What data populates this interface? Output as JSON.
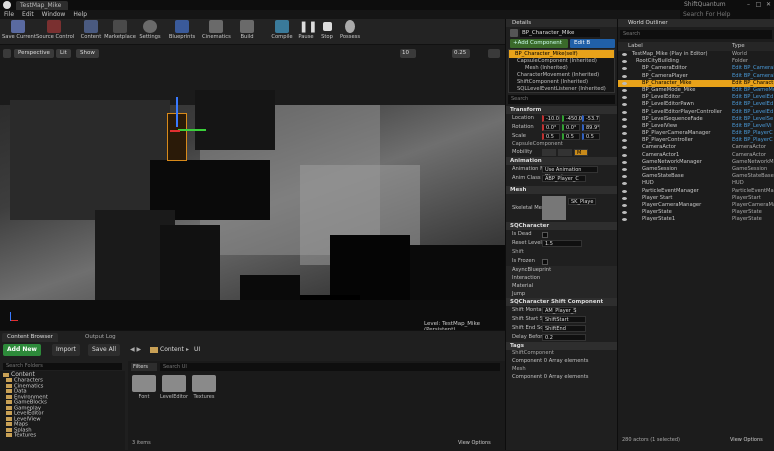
{
  "titlebar": {
    "tab": "TestMap_Mike",
    "project": "ShiftQuantum"
  },
  "menu": [
    "File",
    "Edit",
    "Window",
    "Help"
  ],
  "help_placeholder": "Search For Help",
  "toolbar": [
    {
      "label": "Save Current",
      "color": "#5a6aa0"
    },
    {
      "label": "Source Control",
      "color": "#7a3030"
    },
    {
      "label": "Content",
      "color": "#4a5a80"
    },
    {
      "label": "Marketplace",
      "color": "#4a4a4a"
    },
    {
      "label": "Settings",
      "color": "#6a6a6a"
    },
    {
      "label": "Blueprints",
      "color": "#3a5a9a"
    },
    {
      "label": "Cinematics",
      "color": "#6a6a6a"
    },
    {
      "label": "Build",
      "color": "#6a6a6a"
    },
    {
      "label": "Compile",
      "color": "#3a7a9a"
    },
    {
      "label": "Pause",
      "color": "#aaaaaa"
    },
    {
      "label": "Stop",
      "color": "#aaaaaa"
    },
    {
      "label": "Possess",
      "color": "#aaaaaa"
    }
  ],
  "viewport": {
    "perspective": "Perspective",
    "lit": "Lit",
    "show": "Show",
    "snap1": "10",
    "snap2": "0.25",
    "level": "Level:  TestMap_Mike (Persistent)"
  },
  "content_browser": {
    "tab1": "Content Browser",
    "tab2": "Output Log",
    "add_new": "Add New",
    "import": "Import",
    "save_all": "Save All",
    "path": [
      "Content",
      "UI"
    ],
    "search_folders": "Search Folders",
    "filters": "Filters",
    "search_ui": "Search UI",
    "folders": [
      "Content",
      "Characters",
      "Cinematics",
      "Data",
      "Environment",
      "GameBlocks",
      "Gameplay",
      "LevelEditor",
      "LevelView",
      "Maps",
      "Splash",
      "Textures"
    ],
    "assets": [
      "Font",
      "LevelEditor",
      "Textures"
    ],
    "count": "3 items",
    "view_options": "View Options"
  },
  "details": {
    "tab": "Details",
    "name": "BP_Character_Mike",
    "add_component": "+Add Component",
    "edit_bp": "Edit B",
    "self": "BP_Character_Mike(self)",
    "components": [
      "CapsuleComponent (Inherited)",
      "Mesh (Inherited)",
      "CharacterMovement (Inherited)",
      "ShiftComponent (Inherited)",
      "SQLLevelEventListener (Inherited)"
    ],
    "search": "Search",
    "transform": "Transform",
    "location_lbl": "Location",
    "location": [
      "-10.0",
      "-450.0",
      "-53.7"
    ],
    "rotation_lbl": "Rotation",
    "rotation": [
      "0.0°",
      "0.0°",
      "89.9°"
    ],
    "scale_lbl": "Scale",
    "scale": [
      "0.5",
      "0.5",
      "0.5"
    ],
    "capsule": "CapsuleComponent",
    "mobility_lbl": "Mobility",
    "animation": "Animation",
    "anim_mode_lbl": "Animation Mo",
    "anim_mode": "Use Animation Bluepri",
    "anim_class_lbl": "Anim Class",
    "anim_class": "ABP_Player_C",
    "mesh": "Mesh",
    "skeletal_lbl": "Skeletal Mes",
    "skeletal": "SK_Playe",
    "sqchar": "SQCharacter",
    "is_dead": "Is Dead",
    "reset_level_lbl": "Reset Level T",
    "reset_level": "1.5",
    "shift": "Shift",
    "is_frozen": "Is Frozen",
    "collapsed": [
      "AsyncBlueprint",
      "Interaction",
      "Material",
      "Jump"
    ],
    "sqshift": "SQCharacter Shift Component",
    "shift_montage_lbl": "Shift Montag",
    "shift_montage": "AM_Player_S",
    "shift_start_lbl": "Shift Start So",
    "shift_start": "ShiftStart",
    "shift_end_lbl": "Shift End Soc",
    "shift_end": "ShiftEnd",
    "delay_lbl": "Delay Before",
    "delay": "0.2",
    "tags": "Tags",
    "shiftcomp": "ShiftComponent",
    "comp_arr": "Component  0 Array elements",
    "mesh2": "Mesh",
    "comp_arr2": "Component  0 Array elements"
  },
  "outliner": {
    "tab": "World Outliner",
    "search": "Search",
    "col_label": "Label",
    "col_type": "Type",
    "rows": [
      {
        "name": "TestMap_Mike (Play in Editor)",
        "type": "World",
        "link": false,
        "sel": false
      },
      {
        "name": "RootCityBuilding",
        "type": "Folder",
        "link": false,
        "sel": false
      },
      {
        "name": "BP_CameraEditor",
        "type": "Edit BP_CameraE",
        "link": true,
        "sel": false
      },
      {
        "name": "BP_CameraPlayer",
        "type": "Edit BP_CameraP",
        "link": true,
        "sel": false
      },
      {
        "name": "BP_Character_Mike",
        "type": "Edit BP_Charact",
        "link": true,
        "sel": true
      },
      {
        "name": "BP_GameMode_Mike",
        "type": "Edit BP_GameMo",
        "link": true,
        "sel": false
      },
      {
        "name": "BP_LevelEditor",
        "type": "Edit BP_LevelEd",
        "link": true,
        "sel": false
      },
      {
        "name": "BP_LevelEditorPawn",
        "type": "Edit BP_LevelEd",
        "link": true,
        "sel": false
      },
      {
        "name": "BP_LevelEditorPlayerController",
        "type": "Edit BP_LevelEd",
        "link": true,
        "sel": false
      },
      {
        "name": "BP_LevelSequenceFade",
        "type": "Edit BP_LevelSe",
        "link": true,
        "sel": false
      },
      {
        "name": "BP_LevelView",
        "type": "Edit BP_LevelVi",
        "link": true,
        "sel": false
      },
      {
        "name": "BP_PlayerCameraManager",
        "type": "Edit BP_PlayerC",
        "link": true,
        "sel": false
      },
      {
        "name": "BP_PlayerController",
        "type": "Edit BP_PlayerC",
        "link": true,
        "sel": false
      },
      {
        "name": "CameraActor",
        "type": "CameraActor",
        "link": false,
        "sel": false
      },
      {
        "name": "CameraActor1",
        "type": "CameraActor",
        "link": false,
        "sel": false
      },
      {
        "name": "GameNetworkManager",
        "type": "GameNetworkMa",
        "link": false,
        "sel": false
      },
      {
        "name": "GameSession",
        "type": "GameSession",
        "link": false,
        "sel": false
      },
      {
        "name": "GameStateBase",
        "type": "GameStateBase",
        "link": false,
        "sel": false
      },
      {
        "name": "HUD",
        "type": "HUD",
        "link": false,
        "sel": false
      },
      {
        "name": "ParticleEventManager",
        "type": "ParticleEventMa",
        "link": false,
        "sel": false
      },
      {
        "name": "Player Start",
        "type": "PlayerStart",
        "link": false,
        "sel": false
      },
      {
        "name": "PlayerCameraManager",
        "type": "PlayerCameraMa",
        "link": false,
        "sel": false
      },
      {
        "name": "PlayerState",
        "type": "PlayerState",
        "link": false,
        "sel": false
      },
      {
        "name": "PlayerState1",
        "type": "PlayerState",
        "link": false,
        "sel": false
      }
    ],
    "count": "280 actors (1 selected)",
    "view_options": "View Options"
  }
}
